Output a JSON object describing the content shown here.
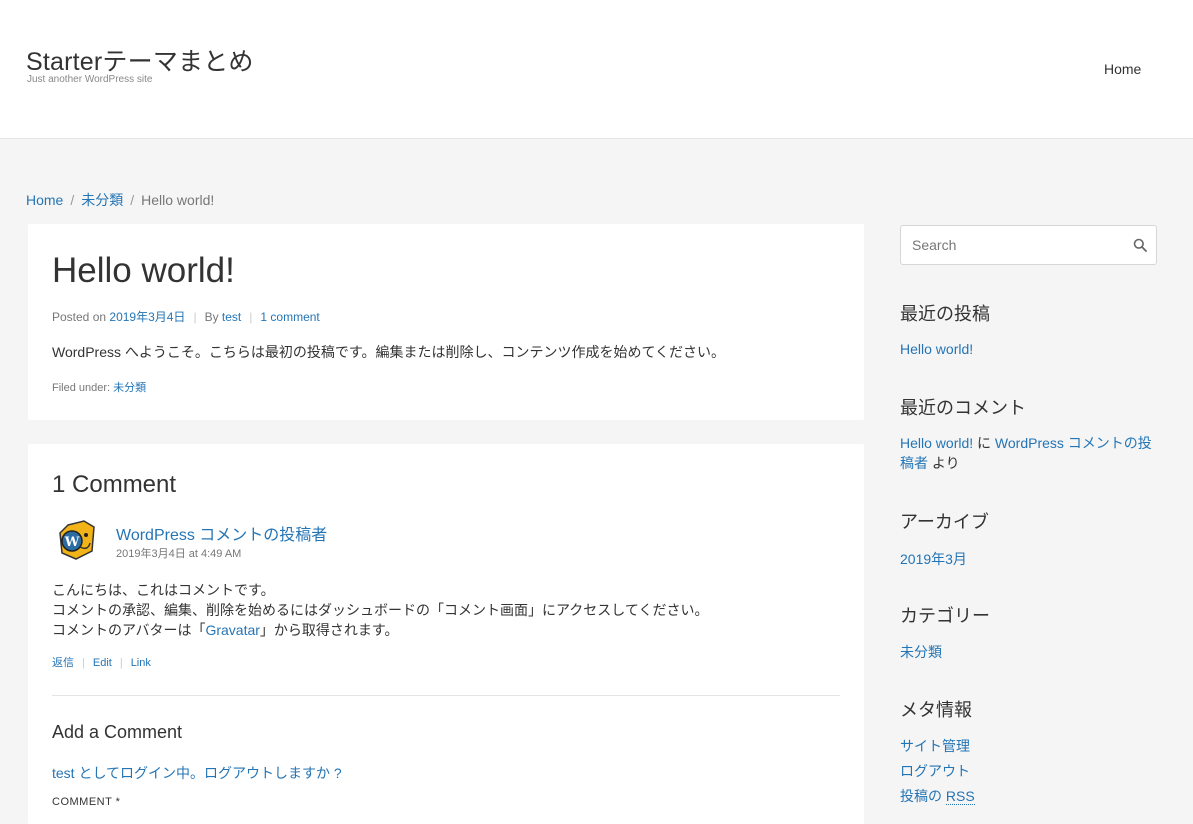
{
  "header": {
    "site_title": "Starterテーマまとめ",
    "site_description": "Just another WordPress site",
    "nav_home": "Home"
  },
  "breadcrumb": {
    "home": "Home",
    "category": "未分類",
    "current": "Hello world!",
    "separator": "/"
  },
  "post": {
    "title": "Hello world!",
    "posted_on_label": "Posted on",
    "date": "2019年3月4日",
    "by_label": "By",
    "author": "test",
    "comments_link": "1 comment",
    "content": "WordPress へようこそ。こちらは最初の投稿です。編集または削除し、コンテンツ作成を始めてください。",
    "filed_under_label": "Filed under:",
    "category": "未分類"
  },
  "comments": {
    "title": "1 Comment",
    "items": [
      {
        "author": "WordPress コメントの投稿者",
        "date": "2019年3月4日 at 4:49 AM",
        "lines": [
          "こんにちは、これはコメントです。",
          "コメントの承認、編集、削除を始めるにはダッシュボードの「コメント画面」にアクセスしてください。"
        ],
        "line3_before": "コメントのアバターは「",
        "line3_link": "Gravatar",
        "line3_after": "」から取得されます。",
        "actions": {
          "reply": "返信",
          "edit": "Edit",
          "link": "Link"
        }
      }
    ],
    "add_title": "Add a Comment",
    "logged_in_as": "test としてログイン中。",
    "logout_prompt": "ログアウトしますか ?",
    "comment_label": "COMMENT *"
  },
  "sidebar": {
    "search_placeholder": "Search",
    "recent_posts": {
      "title": "最近の投稿",
      "items": [
        "Hello world!"
      ]
    },
    "recent_comments": {
      "title": "最近のコメント",
      "post_link": "Hello world!",
      "connector": " に ",
      "author_link": "WordPress コメントの投稿者",
      "suffix": " より"
    },
    "archives": {
      "title": "アーカイブ",
      "items": [
        "2019年3月"
      ]
    },
    "categories": {
      "title": "カテゴリー",
      "items": [
        "未分類"
      ]
    },
    "meta": {
      "title": "メタ情報",
      "items": [
        "サイト管理",
        "ログアウト",
        "投稿の "
      ],
      "rss": "RSS"
    }
  },
  "colors": {
    "link": "#2575b5",
    "background": "#f5f5f5",
    "card": "#ffffff",
    "text": "#333333",
    "muted": "#777777"
  }
}
